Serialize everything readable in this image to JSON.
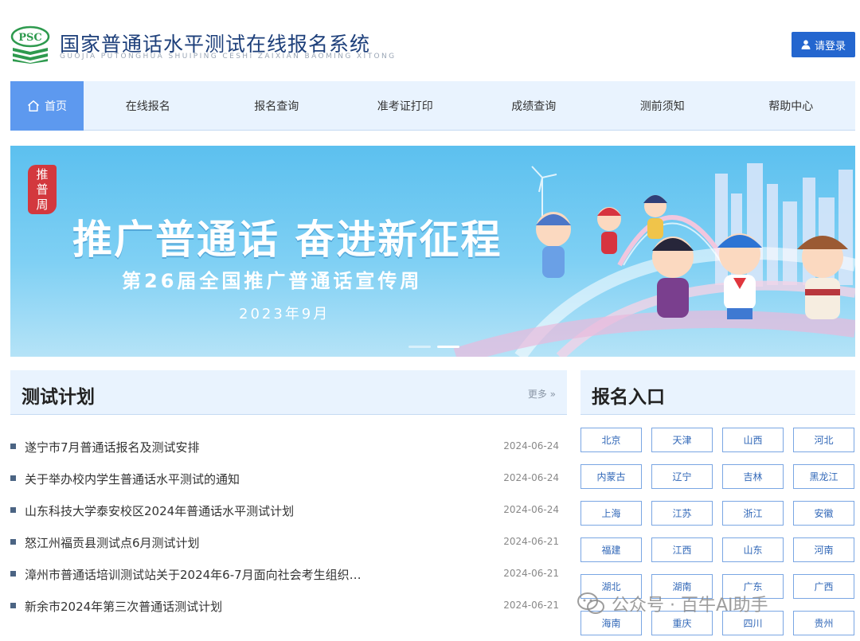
{
  "header": {
    "logo_text": "PSC",
    "site_title": "国家普通话水平测试在线报名系统",
    "site_subtitle": "GUOJIA PUTONGHUA SHUIPING CESHI ZAIXIAN BAOMING XITONG",
    "login_label": "请登录"
  },
  "nav": {
    "home": "首页",
    "items": [
      "在线报名",
      "报名查询",
      "准考证打印",
      "成绩查询",
      "测前须知",
      "帮助中心"
    ]
  },
  "banner": {
    "seal": [
      "推",
      "普",
      "周"
    ],
    "title": "推广普通话 奋进新征程",
    "subtitle": "第26届全国推广普通话宣传周",
    "date": "2023年9月",
    "slide_active": 2,
    "slide_total": 2
  },
  "plan": {
    "title": "测试计划",
    "more": "更多 »",
    "items": [
      {
        "title": "遂宁市7月普通话报名及测试安排",
        "date": "2024-06-24"
      },
      {
        "title": "关于举办校内学生普通话水平测试的通知",
        "date": "2024-06-24"
      },
      {
        "title": "山东科技大学泰安校区2024年普通话水平测试计划",
        "date": "2024-06-24"
      },
      {
        "title": "怒江州福贡县测试点6月测试计划",
        "date": "2024-06-21"
      },
      {
        "title": "漳州市普通话培训测试站关于2024年6-7月面向社会考生组织…",
        "date": "2024-06-21"
      },
      {
        "title": "新余市2024年第三次普通话测试计划",
        "date": "2024-06-21"
      }
    ]
  },
  "register": {
    "title": "报名入口",
    "provinces": [
      "北京",
      "天津",
      "山西",
      "河北",
      "内蒙古",
      "辽宁",
      "吉林",
      "黑龙江",
      "上海",
      "江苏",
      "浙江",
      "安徽",
      "福建",
      "江西",
      "山东",
      "河南",
      "湖北",
      "湖南",
      "广东",
      "广西",
      "海南",
      "重庆",
      "四川",
      "贵州"
    ]
  },
  "watermark": "公众号 · 百牛AI助手",
  "colors": {
    "brand_blue": "#2466cf",
    "nav_bg": "#e9f3fe",
    "nav_active": "#5d99ef",
    "title_navy": "#1d3f7a",
    "logo_green": "#2e9a4e"
  },
  "icons": {
    "login": "user-icon",
    "home": "home-icon",
    "more": "double-chevron-right-icon",
    "watermark": "wechat-icon"
  }
}
